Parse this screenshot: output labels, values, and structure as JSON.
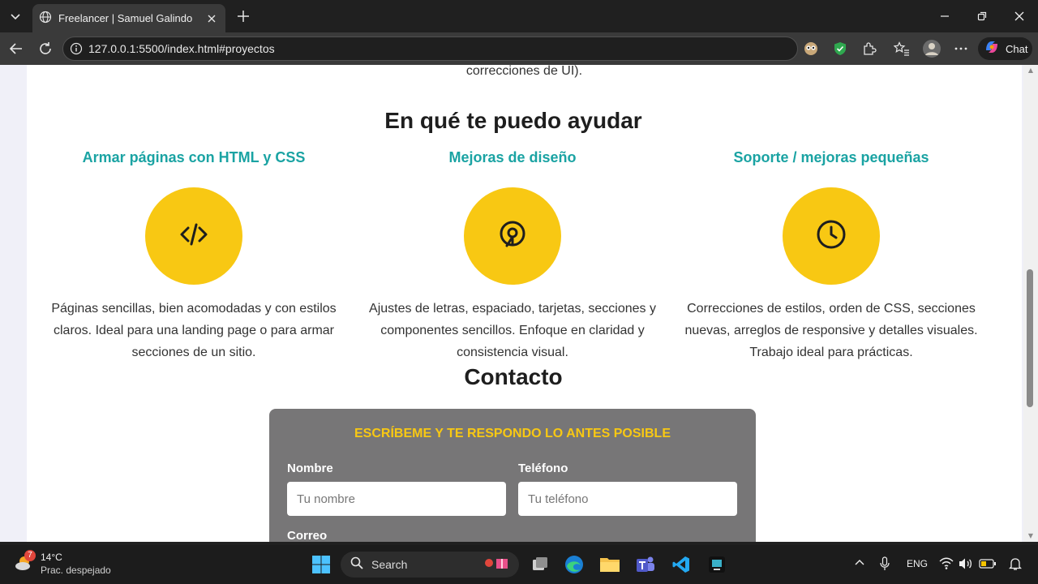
{
  "browser": {
    "tab_title": "Freelancer | Samuel Galindo",
    "url": "127.0.0.1:5500/index.html#proyectos",
    "chat_label": "Chat"
  },
  "page": {
    "prev_text": "correcciones de UI).",
    "services_heading": "En qué te puedo ayudar",
    "services": [
      {
        "title": "Armar páginas con HTML y CSS",
        "icon": "code-icon",
        "desc": "Páginas sencillas, bien acomodadas y con estilos claros. Ideal para una landing page o para armar secciones de un sitio."
      },
      {
        "title": "Mejoras de diseño",
        "icon": "location-pin-icon",
        "desc": "Ajustes de letras, espaciado, tarjetas, secciones y componentes sencillos. Enfoque en claridad y consistencia visual."
      },
      {
        "title": "Soporte / mejoras pequeñas",
        "icon": "clock-icon",
        "desc": "Correcciones de estilos, orden de CSS, secciones nuevas, arreglos de responsive y detalles visuales. Trabajo ideal para prácticas."
      }
    ],
    "contact_heading": "Contacto",
    "form": {
      "title": "ESCRÍBEME Y TE RESPONDO LO ANTES POSIBLE",
      "name_label": "Nombre",
      "name_placeholder": "Tu nombre",
      "phone_label": "Teléfono",
      "phone_placeholder": "Tu teléfono",
      "email_label": "Correo"
    }
  },
  "taskbar": {
    "weather_temp": "14°C",
    "weather_condition": "Prac. despejado",
    "weather_badge": "7",
    "search_label": "Search",
    "language": "ENG"
  },
  "colors": {
    "accent_teal": "#1aa3a3",
    "accent_yellow": "#f8c813",
    "form_bg": "#777677"
  }
}
